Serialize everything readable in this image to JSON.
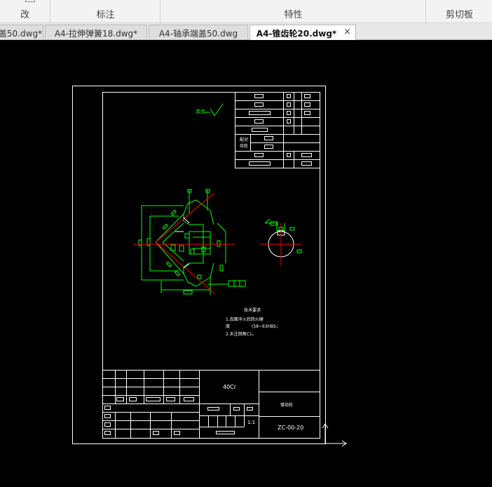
{
  "ribbon": {
    "groups": [
      {
        "label": "改"
      },
      {
        "label": "标注"
      },
      {
        "label": "特性"
      },
      {
        "label": "剪切板"
      }
    ]
  },
  "tabs": [
    {
      "label": "盖50.dwg*",
      "active": false
    },
    {
      "label": "A4-拉伸弹簧18.dwg*",
      "active": false
    },
    {
      "label": "A4-轴承端盖50.dwg",
      "active": false
    },
    {
      "label": "A4-锥齿轮20.dwg*",
      "active": true
    }
  ],
  "tab_close_glyph": "×",
  "drawing": {
    "tech_req": {
      "title": "技术要求",
      "line1": "1.齿面淬火后回火硬",
      "line2a": "度",
      "line2b": "(58~63HBS；",
      "line3": "2.未注倒角C1。"
    },
    "title_block": {
      "material": "40Cr",
      "part_name": "锥齿轮",
      "scale": "1:1",
      "drawing_no": "ZC-00-20"
    },
    "param_table_labels": {
      "mating": "配对",
      "gear": "齿轮"
    },
    "roughness_note": "其余"
  },
  "colors": {
    "canvas_bg": "#000000",
    "line_white": "#ffffff",
    "line_green": "#00ff00",
    "line_red": "#ff0000"
  }
}
